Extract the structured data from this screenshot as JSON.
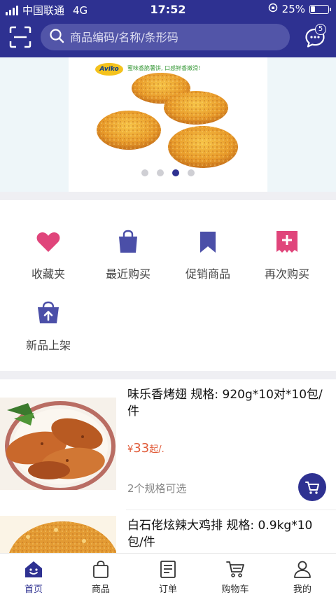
{
  "status_bar": {
    "carrier": "中国联通",
    "network": "4G",
    "time": "17:52",
    "battery": "25%",
    "battery_level": 0.25
  },
  "header": {
    "search_placeholder": "商品编码/名称/条形码",
    "message_count": "5"
  },
  "banner": {
    "brand": "Aviko",
    "tagline": "蜜味香脆薯饼, 口感鲜香嫩滑!",
    "slide_count": 4,
    "active_slide": 3
  },
  "quick_menu": [
    {
      "label": "收藏夹",
      "icon": "heart-icon"
    },
    {
      "label": "最近购买",
      "icon": "shopping-bag-icon"
    },
    {
      "label": "促销商品",
      "icon": "bookmark-icon"
    },
    {
      "label": "再次购买",
      "icon": "plus-ticket-icon"
    },
    {
      "label": "新品上架",
      "icon": "basket-upload-icon"
    }
  ],
  "products": [
    {
      "title": "味乐香烤翅 规格: 920g*10对*10包/件",
      "price_prefix": "¥",
      "price": "33",
      "price_suffix": "起/.",
      "specs": "2个规格可选"
    },
    {
      "title": "白石佬炫辣大鸡排 规格: 0.9kg*10包/件"
    }
  ],
  "tabs": [
    {
      "label": "首页",
      "icon": "home-icon",
      "active": true
    },
    {
      "label": "商品",
      "icon": "bag-icon"
    },
    {
      "label": "订单",
      "icon": "order-list-icon"
    },
    {
      "label": "购物车",
      "icon": "cart-icon"
    },
    {
      "label": "我的",
      "icon": "user-icon"
    }
  ],
  "colors": {
    "primary": "#2e3191",
    "price": "#e05a38",
    "icon_pink": "#e0457b"
  }
}
